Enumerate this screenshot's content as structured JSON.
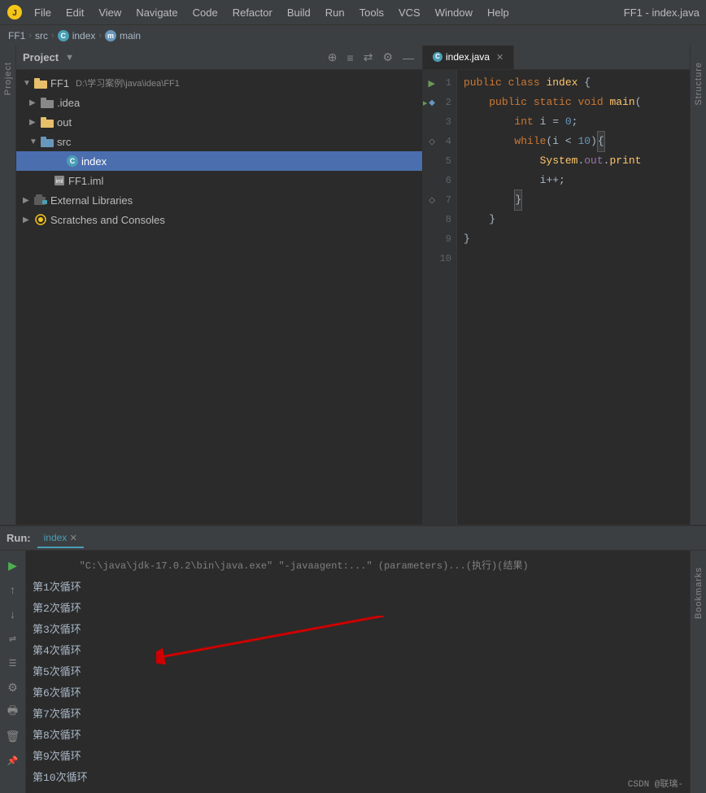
{
  "app": {
    "title": "FF1 - index.java",
    "icon": "💡"
  },
  "menu": {
    "items": [
      "File",
      "Edit",
      "View",
      "Navigate",
      "Code",
      "Refactor",
      "Build",
      "Run",
      "Tools",
      "VCS",
      "Window",
      "Help"
    ]
  },
  "breadcrumb": {
    "items": [
      "FF1",
      "src",
      "index",
      "main"
    ]
  },
  "project_panel": {
    "title": "Project",
    "root": {
      "name": "FF1",
      "path": "D:\\学习案例\\java\\idea\\FF1",
      "children": [
        {
          "name": ".idea",
          "type": "folder_dot",
          "indent": 1,
          "expanded": false
        },
        {
          "name": "out",
          "type": "folder_out",
          "indent": 1,
          "expanded": false
        },
        {
          "name": "src",
          "type": "folder_src",
          "indent": 1,
          "expanded": true
        },
        {
          "name": "index",
          "type": "class",
          "indent": 2,
          "selected": true
        },
        {
          "name": "FF1.iml",
          "type": "iml",
          "indent": 1
        },
        {
          "name": "External Libraries",
          "type": "ext_lib",
          "indent": 0,
          "expanded": false
        },
        {
          "name": "Scratches and Consoles",
          "type": "scratches",
          "indent": 0,
          "expanded": false
        }
      ]
    }
  },
  "editor": {
    "tabs": [
      {
        "name": "index.java",
        "active": true,
        "icon": "c"
      }
    ],
    "lines": [
      {
        "num": 1,
        "run": true,
        "bookmark": false,
        "code": "public_class_index_open"
      },
      {
        "num": 2,
        "run": true,
        "bookmark": true,
        "code": "public_static_void_main"
      },
      {
        "num": 3,
        "run": false,
        "bookmark": false,
        "code": "int_i_eq_0"
      },
      {
        "num": 4,
        "run": false,
        "bookmark": true,
        "code": "while_i_lt_10"
      },
      {
        "num": 5,
        "run": false,
        "bookmark": false,
        "code": "system_out_println"
      },
      {
        "num": 6,
        "run": false,
        "bookmark": false,
        "code": "blank"
      },
      {
        "num": 7,
        "run": false,
        "bookmark": true,
        "code": "close_brace_1"
      },
      {
        "num": 8,
        "run": false,
        "bookmark": false,
        "code": "close_brace_2"
      },
      {
        "num": 9,
        "run": false,
        "bookmark": false,
        "code": "close_brace_3"
      },
      {
        "num": 10,
        "run": false,
        "bookmark": false,
        "code": "blank"
      }
    ]
  },
  "run_panel": {
    "label": "Run:",
    "tab": "index",
    "cmd_line": "\"C:\\java\\jdk-17.0.2\\bin\\java.exe\" \"-javaagent:...\" ...",
    "output": [
      "第1次循环",
      "第2次循环",
      "第3次循环",
      "第4次循环",
      "第5次循环",
      "第6次循环",
      "第7次循环",
      "第8次循环",
      "第9次循环",
      "第10次循环"
    ]
  },
  "sidebars": {
    "left_label": "Project",
    "right_top": "Structure",
    "right_bottom": "Bookmarks"
  },
  "bottom_right": "CSDN @联璃-"
}
